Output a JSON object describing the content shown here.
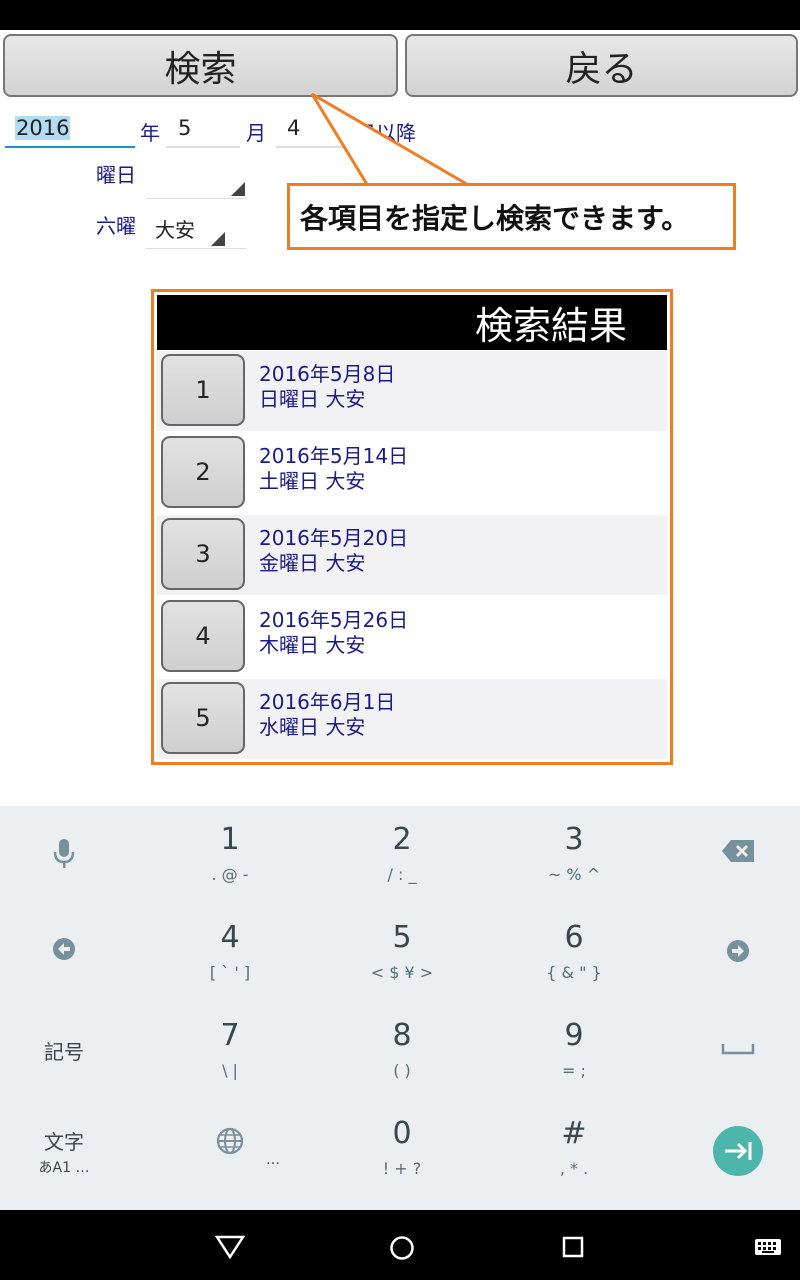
{
  "toolbar": {
    "search_label": "検索",
    "back_label": "戻る"
  },
  "form": {
    "year_value": "2016",
    "year_unit": "年",
    "month_value": "5",
    "month_unit": "月",
    "day_value": "4",
    "day_unit": "日以降",
    "weekday_label": "曜日",
    "weekday_value": "",
    "rokuyo_label": "六曜",
    "rokuyo_value": "大安"
  },
  "callout": {
    "text": "各項目を指定し検索できます。"
  },
  "results": {
    "header": "検索結果",
    "rows": [
      {
        "num": "1",
        "date": "2016年5月8日",
        "info": "日曜日 大安"
      },
      {
        "num": "2",
        "date": "2016年5月14日",
        "info": "土曜日 大安"
      },
      {
        "num": "3",
        "date": "2016年5月20日",
        "info": "金曜日 大安"
      },
      {
        "num": "4",
        "date": "2016年5月26日",
        "info": "木曜日 大安"
      },
      {
        "num": "5",
        "date": "2016年6月1日",
        "info": "水曜日 大安"
      }
    ]
  },
  "keyboard": {
    "keys": [
      {
        "main": "1",
        "sub": ". @ -"
      },
      {
        "main": "2",
        "sub": "/ : _"
      },
      {
        "main": "3",
        "sub": "~ % ^"
      },
      {
        "main": "4",
        "sub": "[ ` ' ]"
      },
      {
        "main": "5",
        "sub": "< $ ¥ >"
      },
      {
        "main": "6",
        "sub": "{ & \" }"
      },
      {
        "main": "7",
        "sub": "\\   |"
      },
      {
        "main": "8",
        "sub": "(   )"
      },
      {
        "main": "9",
        "sub": "=   ;"
      },
      {
        "main": "0",
        "sub": "! + ?"
      },
      {
        "main": "#",
        "sub": ", * ."
      }
    ],
    "symbols_label": "記号",
    "mode_label": "文字",
    "mode_sub": "あA1",
    "ellipsis": "…"
  },
  "colors": {
    "accent": "#ef7d22",
    "link_text": "#1a1a8a",
    "enter_key": "#4db6ac"
  }
}
